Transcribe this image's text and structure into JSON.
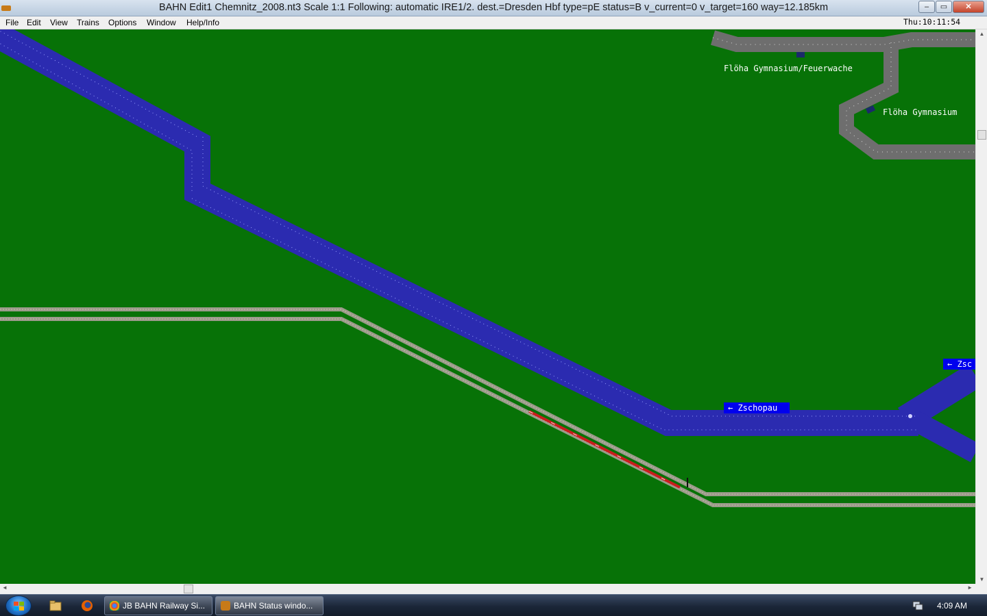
{
  "window": {
    "title": "BAHN Edit1 Chemnitz_2008.nt3 Scale 1:1 Following: automatic IRE1/2.  dest.=Dresden Hbf type=pE status=B  v_current=0 v_target=160 way=12.185km",
    "min_glyph": "–",
    "max_glyph": "▭",
    "close_glyph": "✕"
  },
  "menu": {
    "items": [
      "File",
      "Edit",
      "View",
      "Trains",
      "Options",
      "Window",
      "Help/Info"
    ],
    "clock": "Thu:10:11:54"
  },
  "map": {
    "labels": {
      "station_1": "Flöha Gymnasium/Feuerwache",
      "station_2": "Flöha Gymnasium"
    },
    "signs": {
      "zschopau": "← Zschopau",
      "zsc": "← Zsc"
    },
    "colors": {
      "grass": "#077207",
      "road": "#2b2bb0",
      "street": "#6e6e6e",
      "track": "#9a9a8a",
      "sign": "#0000ee"
    }
  },
  "scrollbars": {
    "up": "▲",
    "down": "▼",
    "left": "◄",
    "right": "►"
  },
  "taskbar": {
    "tasks": [
      "JB BAHN Railway Si...",
      "BAHN Status windo..."
    ],
    "time": "4:09 AM"
  }
}
